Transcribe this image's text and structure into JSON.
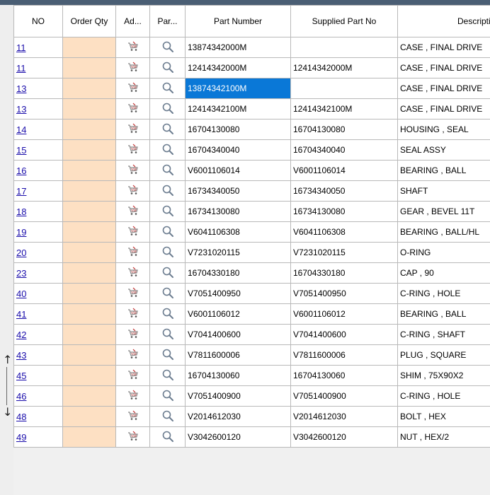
{
  "columns": [
    "NO",
    "Order Qty",
    "Ad...",
    "Par...",
    "Part Number",
    "Supplied Part No",
    "Description"
  ],
  "rows": [
    {
      "no": "11",
      "part": "13874342000M",
      "supplied": "",
      "desc": "CASE , FINAL DRIVE",
      "selected": false
    },
    {
      "no": " 11",
      "part": "12414342000M",
      "supplied": "12414342000M",
      "desc": "CASE , FINAL DRIVE",
      "selected": false
    },
    {
      "no": "13",
      "part": "13874342100M",
      "supplied": "",
      "desc": "CASE , FINAL DRIVE",
      "selected": true
    },
    {
      "no": " 13",
      "part": "12414342100M",
      "supplied": "12414342100M",
      "desc": "CASE , FINAL DRIVE",
      "selected": false
    },
    {
      "no": "14",
      "part": "16704130080",
      "supplied": "16704130080",
      "desc": "HOUSING , SEAL",
      "selected": false
    },
    {
      "no": "15",
      "part": "16704340040",
      "supplied": "16704340040",
      "desc": "SEAL ASSY",
      "selected": false
    },
    {
      "no": "16",
      "part": "V6001106014",
      "supplied": "V6001106014",
      "desc": "BEARING , BALL",
      "selected": false
    },
    {
      "no": "17",
      "part": "16734340050",
      "supplied": "16734340050",
      "desc": "SHAFT",
      "selected": false
    },
    {
      "no": "18",
      "part": "16734130080",
      "supplied": "16734130080",
      "desc": "GEAR , BEVEL 11T",
      "selected": false
    },
    {
      "no": "19",
      "part": "V6041106308",
      "supplied": "V6041106308",
      "desc": "BEARING , BALL/HL",
      "selected": false
    },
    {
      "no": "20",
      "part": "V7231020115",
      "supplied": "V7231020115",
      "desc": "O-RING",
      "selected": false
    },
    {
      "no": "23",
      "part": "16704330180",
      "supplied": "16704330180",
      "desc": "CAP , 90",
      "selected": false
    },
    {
      "no": "40",
      "part": "V7051400950",
      "supplied": "V7051400950",
      "desc": "C-RING , HOLE",
      "selected": false
    },
    {
      "no": "41",
      "part": "V6001106012",
      "supplied": "V6001106012",
      "desc": "BEARING , BALL",
      "selected": false
    },
    {
      "no": "42",
      "part": "V7041400600",
      "supplied": "V7041400600",
      "desc": "C-RING , SHAFT",
      "selected": false
    },
    {
      "no": "43",
      "part": "V7811600006",
      "supplied": "V7811600006",
      "desc": "PLUG , SQUARE",
      "selected": false
    },
    {
      "no": "45",
      "part": "16704130060",
      "supplied": "16704130060",
      "desc": "SHIM , 75X90X2",
      "selected": false
    },
    {
      "no": "46",
      "part": "V7051400900",
      "supplied": "V7051400900",
      "desc": "C-RING , HOLE",
      "selected": false
    },
    {
      "no": "48",
      "part": "V2014612030",
      "supplied": "V2014612030",
      "desc": "BOLT , HEX",
      "selected": false
    },
    {
      "no": "49",
      "part": "V3042600120",
      "supplied": "V3042600120",
      "desc": "NUT , HEX/2",
      "selected": false
    }
  ],
  "icons": {
    "add": "cart-icon",
    "parts": "magnifier-icon",
    "resize": "up-down-arrow-icon"
  },
  "colors": {
    "qty_bg": "#fde0c3",
    "selection": "#0a78d7",
    "link": "#1a0dab",
    "titlebar": "#4a5e74"
  },
  "resize_arrows": {
    "up": "↑",
    "down": "↓"
  }
}
